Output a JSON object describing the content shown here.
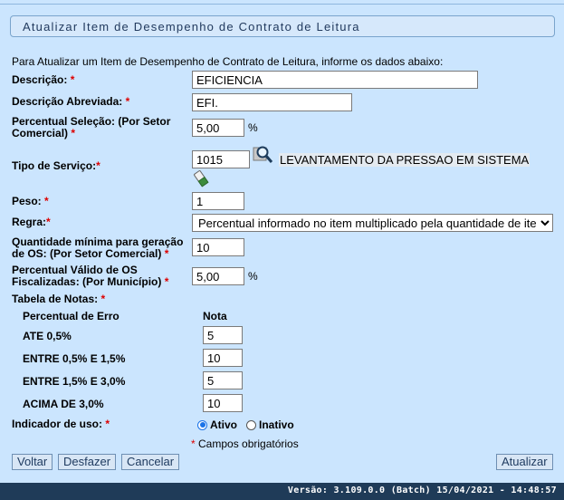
{
  "page": {
    "title": "Atualizar Item de Desempenho de Contrato de Leitura",
    "intro": "Para Atualizar um Item de Desempenho de Contrato de Leitura, informe os dados abaixo:"
  },
  "form": {
    "descricao": {
      "label": "Descrição:",
      "value": "EFICIENCIA"
    },
    "descricao_abreviada": {
      "label": "Descrição Abreviada:",
      "value": "EFI."
    },
    "percentual_selecao": {
      "label_line1": "Percentual Seleção: (Por Setor",
      "label_line2": "Comercial)",
      "value": "5,00",
      "unit": "%"
    },
    "tipo_servico": {
      "label": "Tipo de Serviço:",
      "code": "1015",
      "description": "LEVANTAMENTO DA PRESSAO EM SISTEMA"
    },
    "peso": {
      "label": "Peso:",
      "value": "1"
    },
    "regra": {
      "label": "Regra:",
      "selected": "Percentual informado no item multiplicado pela quantidade de itens"
    },
    "quantidade_minima": {
      "label_line1": "Quantidade mínima para geração",
      "label_line2": "de OS: (Por Setor Comercial)",
      "value": "10"
    },
    "percentual_valido": {
      "label_line1": "Percentual Válido de OS",
      "label_line2": "Fiscalizadas: (Por Município)",
      "value": "5,00",
      "unit": "%"
    },
    "tabela_notas": {
      "label": "Tabela de Notas:",
      "col_percentual": "Percentual de Erro",
      "col_nota": "Nota",
      "rows": [
        {
          "faixa": "ATE 0,5%",
          "nota": "5"
        },
        {
          "faixa": "ENTRE 0,5% E 1,5%",
          "nota": "10"
        },
        {
          "faixa": "ENTRE 1,5% E 3,0%",
          "nota": "5"
        },
        {
          "faixa": "ACIMA DE 3,0%",
          "nota": "10"
        }
      ]
    },
    "indicador_uso": {
      "label": "Indicador de uso:",
      "option_ativo": "Ativo",
      "option_inativo": "Inativo",
      "selected": "Ativo"
    },
    "required_mark": "*",
    "required_note": "Campos obrigatórios"
  },
  "buttons": {
    "voltar": "Voltar",
    "desfazer": "Desfazer",
    "cancelar": "Cancelar",
    "atualizar": "Atualizar"
  },
  "footer": {
    "version": "Versão: 3.109.0.0 (Batch) 15/04/2021 - 14:48:57"
  },
  "colors": {
    "background": "#cbe5fe",
    "footer": "#1f3b58",
    "required": "#dd0000"
  },
  "icons": {
    "search": "magnifier-icon",
    "clear": "eraser-icon"
  }
}
